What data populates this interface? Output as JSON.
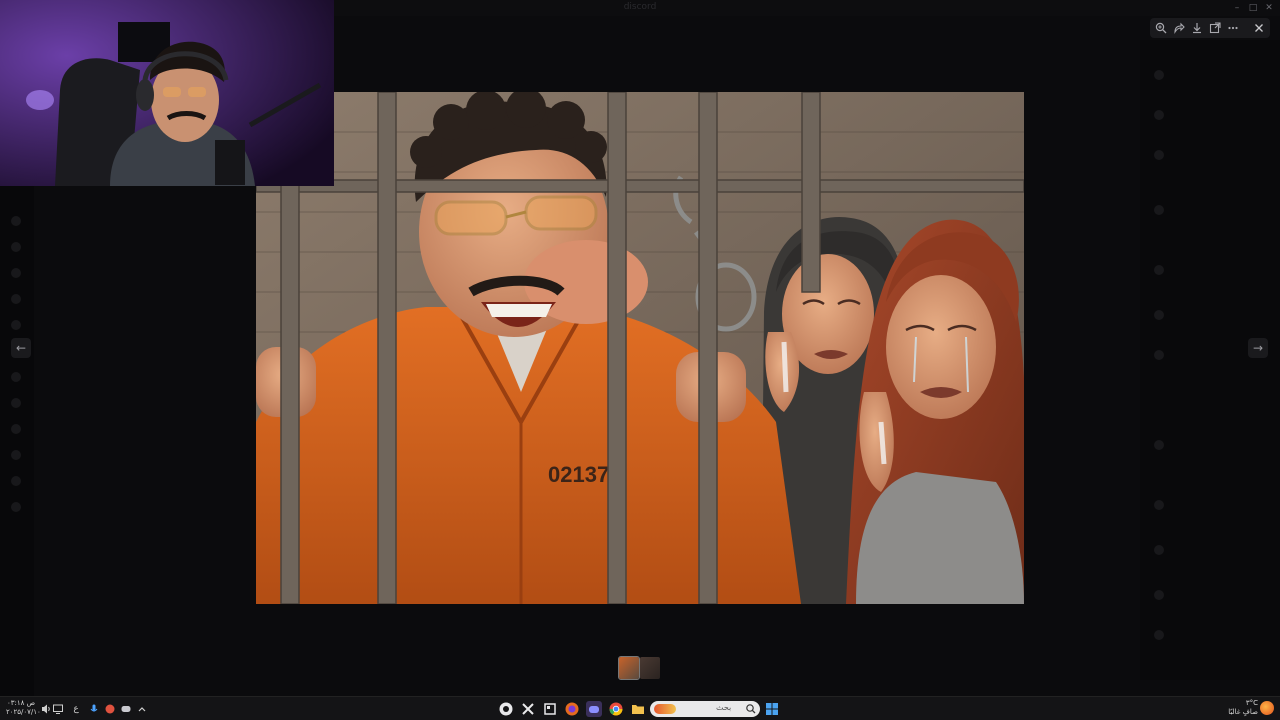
{
  "window": {
    "title": "discord",
    "controls": {
      "minimize": "–",
      "maximize": "□",
      "close": "✕"
    }
  },
  "viewer": {
    "toolbar": {
      "zoom_icon": "zoom-in-icon",
      "share_icon": "share-icon",
      "download_icon": "download-icon",
      "open_icon": "open-external-icon",
      "more_icon": "more-icon",
      "close_icon": "close-icon"
    },
    "prev_arrow": "←",
    "next_arrow": "→",
    "image": {
      "prisoner_number": "02137A"
    }
  },
  "taskbar": {
    "clock": {
      "time": "۰۳:۱۸ ص",
      "date": "۲۰۲۵/۰۷/۱۰"
    },
    "tray_lang": "ع",
    "search_placeholder": "بحث",
    "weather": {
      "temp": "۳°C",
      "condition": "صافٍ غالبًا"
    }
  },
  "colors": {
    "accent": "#e36b1e",
    "jumpsuit": "#d8611d",
    "bars": "#6f655b",
    "taskbar": "#141416"
  }
}
